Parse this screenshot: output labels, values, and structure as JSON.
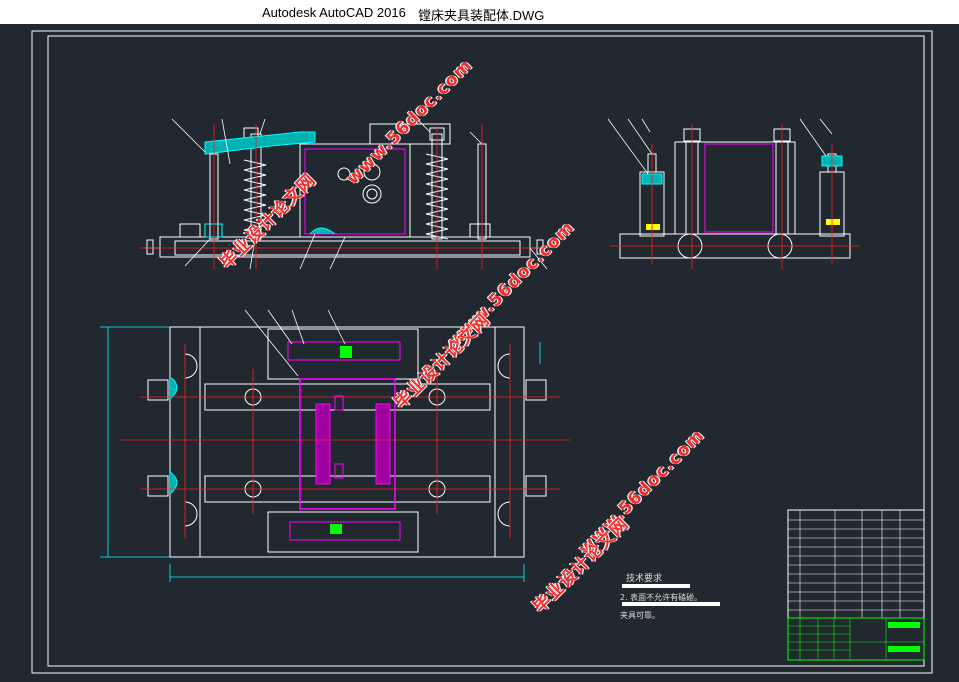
{
  "window": {
    "app_title": "Autodesk AutoCAD 2016",
    "document_title": "镗床夹具装配体.DWG"
  },
  "drawing": {
    "tech_requirements_title": "技术要求",
    "note_1": "2. 表面不允许有磕碰。",
    "note_2": "夹具可靠。"
  },
  "watermarks": {
    "text_a": "毕业设计论文网",
    "text_b": "www.56doc.com"
  },
  "colors": {
    "background": "#212830",
    "line_white": "#ffffff",
    "center_line": "#ff2020",
    "magenta": "#ff00ff",
    "cyan": "#00ffff",
    "green": "#00ff00"
  }
}
